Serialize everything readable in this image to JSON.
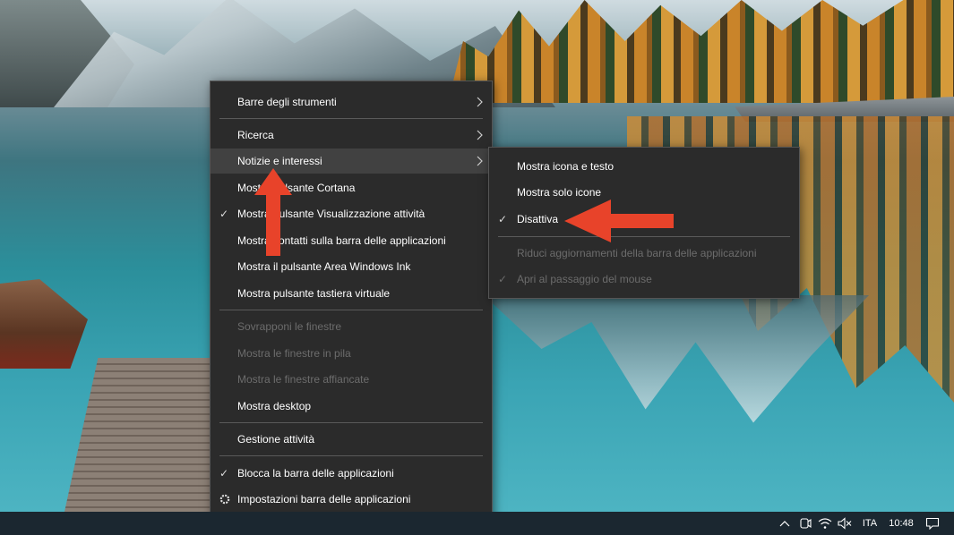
{
  "context_menu": {
    "items": [
      {
        "label": "Barre degli strumenti",
        "submenu": true
      },
      {
        "label": "Ricerca",
        "submenu": true
      },
      {
        "label": "Notizie e interessi",
        "submenu": true,
        "highlighted": true
      },
      {
        "label": "Mostra pulsante Cortana"
      },
      {
        "label": "Mostra pulsante Visualizzazione attività",
        "checked": true
      },
      {
        "label": "Mostra contatti sulla barra delle applicazioni"
      },
      {
        "label": "Mostra il pulsante Area Windows Ink"
      },
      {
        "label": "Mostra pulsante tastiera virtuale"
      },
      {
        "label": "Sovrapponi le finestre",
        "disabled": true
      },
      {
        "label": "Mostra le finestre in pila",
        "disabled": true
      },
      {
        "label": "Mostra le finestre affiancate",
        "disabled": true
      },
      {
        "label": "Mostra desktop"
      },
      {
        "label": "Gestione attività"
      },
      {
        "label": "Blocca la barra delle applicazioni",
        "checked": true
      },
      {
        "label": "Impostazioni barra delle applicazioni",
        "icon": "gear-icon"
      }
    ]
  },
  "submenu": {
    "items": [
      {
        "label": "Mostra icona e testo"
      },
      {
        "label": "Mostra solo icone"
      },
      {
        "label": "Disattiva",
        "checked": true
      },
      {
        "label": "Riduci aggiornamenti della barra delle applicazioni",
        "disabled": true
      },
      {
        "label": "Apri al passaggio del mouse",
        "checked": true,
        "disabled": true
      }
    ]
  },
  "checkmark": "✓",
  "taskbar": {
    "language": "ITA",
    "time": "10:48",
    "tray_icons": [
      "chevron-up-icon",
      "meet-now-icon",
      "network-icon",
      "volume-muted-icon",
      "notification-icon"
    ]
  },
  "colors": {
    "menu_bg": "#2b2b2b",
    "menu_hover": "#414141",
    "disabled_text": "#6c6c6c",
    "annotation_arrow": "#e8432a",
    "taskbar_bg": "#1b2730"
  }
}
